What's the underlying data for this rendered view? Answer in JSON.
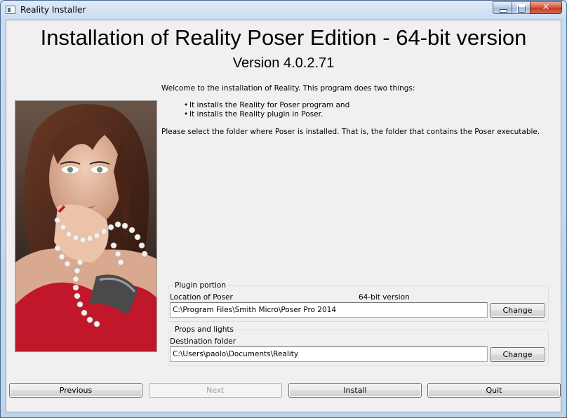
{
  "window": {
    "title": "Reality Installer",
    "controls": {
      "minimize": "minimize-icon",
      "maximize": "maximize-icon",
      "close": "close-icon"
    }
  },
  "header": {
    "title": "Installation of Reality Poser Edition - 64-bit version",
    "version": "Version 4.0.2.71"
  },
  "intro": {
    "welcome": "Welcome to the installation of Reality. This program does two things:",
    "bullets": [
      "It installs the Reality for Poser program and",
      "It installs the Reality plugin in Poser."
    ],
    "instruction": "Please select the folder where Poser is installed. That is, the folder that contains the Poser executable."
  },
  "plugin_group": {
    "title": "Plugin portion",
    "location_label": "Location of Poser",
    "bitness": "64-bit version",
    "path": "C:\\Program Files\\Smith Micro\\Poser Pro 2014",
    "change_label": "Change"
  },
  "props_group": {
    "title": "Props and lights",
    "destination_label": "Destination folder",
    "path": "C:\\Users\\paolo\\Documents\\Reality",
    "change_label": "Change"
  },
  "footer": {
    "previous": "Previous",
    "next": "Next",
    "install": "Install",
    "quit": "Quit"
  }
}
